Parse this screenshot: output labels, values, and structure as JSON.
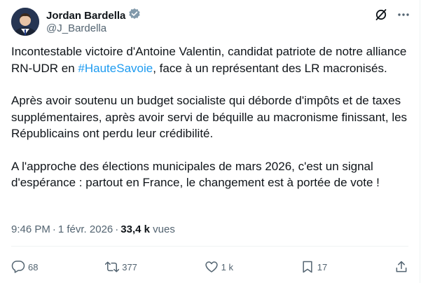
{
  "author": {
    "name": "Jordan Bardella",
    "handle": "@J_Bardella"
  },
  "post": {
    "p1_before": "Incontestable victoire d'Antoine Valentin, candidat patriote de notre alliance RN-UDR en ",
    "p1_hashtag": "#HauteSavoie",
    "p1_after": ", face à un représentant des LR macronisés.",
    "p2": "Après avoir soutenu un budget socialiste qui déborde d'impôts et de taxes supplémentaires, après avoir servi de béquille au macronisme finissant, les Républicains ont perdu leur crédibilité.",
    "p3": "A l'approche des élections municipales de mars 2026, c'est un signal d'espérance : partout en France, le changement est à portée de vote !"
  },
  "meta": {
    "time": "9:46 PM",
    "date": "1 févr. 2026",
    "views_count": "33,4 k",
    "views_label": "vues"
  },
  "actions": {
    "replies": "68",
    "reposts": "377",
    "likes": "1 k",
    "bookmarks": "17"
  },
  "colors": {
    "accent": "#1d9bf0",
    "secondary_text": "#536471",
    "primary_text": "#0f1419",
    "verified_badge": "#829aab"
  }
}
